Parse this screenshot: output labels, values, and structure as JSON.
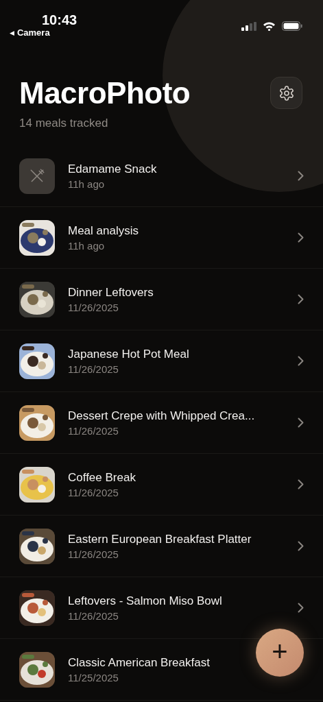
{
  "status_bar": {
    "time": "10:43",
    "back_arrow": "◀",
    "back_label": "Camera"
  },
  "header": {
    "title": "MacroPhoto",
    "subtitle": "14 meals tracked"
  },
  "meals": [
    {
      "kind": "placeholder",
      "name": "Edamame Snack",
      "time": "11h ago",
      "chevron": true
    },
    {
      "kind": "picture",
      "name": "Meal analysis",
      "time": "11h ago",
      "chevron": true
    },
    {
      "kind": "picture",
      "name": "Dinner Leftovers",
      "time": "11/26/2025",
      "chevron": true
    },
    {
      "kind": "picture",
      "name": "Japanese Hot Pot Meal",
      "time": "11/26/2025",
      "chevron": true
    },
    {
      "kind": "picture",
      "name": "Dessert Crepe with Whipped Crea...",
      "time": "11/26/2025",
      "chevron": true
    },
    {
      "kind": "picture",
      "name": "Coffee Break",
      "time": "11/26/2025",
      "chevron": true
    },
    {
      "kind": "picture",
      "name": "Eastern European Breakfast Platter",
      "time": "11/26/2025",
      "chevron": true
    },
    {
      "kind": "picture",
      "name": "Leftovers - Salmon Miso Bowl",
      "time": "11/26/2025",
      "chevron": true
    },
    {
      "kind": "picture",
      "name": "Classic American Breakfast",
      "time": "11/25/2025",
      "chevron": false
    }
  ],
  "add_button": {
    "label": "+"
  }
}
